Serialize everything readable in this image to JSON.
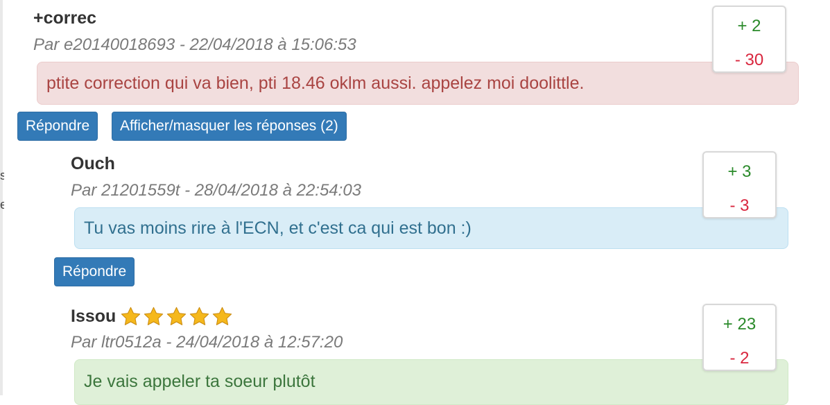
{
  "colors": {
    "vote_up": "#2a8a2a",
    "vote_down": "#d9263e",
    "button_bg": "#337ab7",
    "danger_bg": "#f2dede",
    "info_bg": "#d9edf7",
    "success_bg": "#dff0d8",
    "star_fill": "#f5b81c"
  },
  "left_fragments": [
    "s",
    "e"
  ],
  "comments": [
    {
      "title": "+correc",
      "meta": "Par e20140018693 - 22/04/2018 à 15:06:53",
      "text": "ptite correction qui va bien, pti 18.46 oklm aussi. appelez moi doolittle.",
      "votes_up": "+ 2",
      "votes_down": "- 30",
      "reply_label": "Répondre",
      "toggle_label": "Afficher/masquer les réponses (2)"
    },
    {
      "title": "Ouch",
      "meta": "Par 21201559t - 28/04/2018 à 22:54:03",
      "text": "Tu vas moins rire à l'ECN, et c'est ca qui est bon :)",
      "votes_up": "+ 3",
      "votes_down": "- 3",
      "reply_label": "Répondre"
    },
    {
      "title": "Issou",
      "rating_stars": 5,
      "meta": "Par ltr0512a - 24/04/2018 à 12:57:20",
      "text": "Je vais appeler ta soeur plutôt",
      "votes_up": "+ 23",
      "votes_down": "- 2"
    }
  ]
}
